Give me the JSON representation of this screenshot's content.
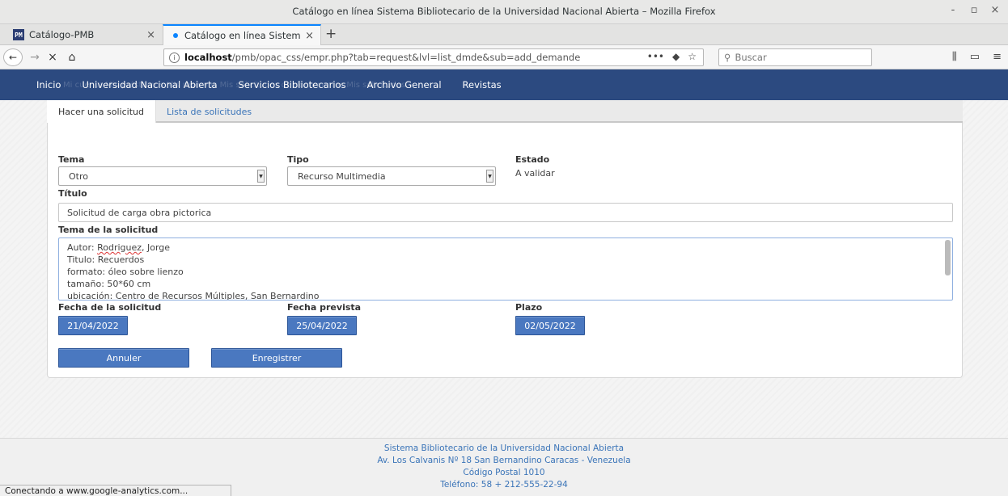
{
  "window": {
    "title": "Catálogo en línea Sistema Bibliotecario de la Universidad Nacional Abierta – Mozilla Firefox",
    "controls": {
      "minimize": "-",
      "maximize": "▫",
      "close": "×"
    }
  },
  "tabs": [
    {
      "label": "Catálogo-PMB",
      "close": "×",
      "favicon": "pmb-favicon"
    },
    {
      "label": "Catálogo en línea Sistem",
      "close": "×",
      "favicon": "loading-dot"
    }
  ],
  "newtab": "+",
  "nav": {
    "back": "←",
    "forward": "→",
    "stop": "×",
    "home": "⌂",
    "url_host": "localhost",
    "url_rest": "/pmb/opac_css/empr.php?tab=request&lvl=list_dmde&sub=add_demande",
    "url_more": "•••",
    "pocket": "◆",
    "star": "☆",
    "search_placeholder": "Buscar",
    "library": "⫼",
    "sidebar": "▭",
    "menu": "≡"
  },
  "sitemenu": {
    "items": [
      "Inicio",
      "Universidad Nacional Abierta",
      "Servicios Bibliotecarios",
      "Archivo General",
      "Revistas"
    ],
    "ghost_text": "Mi cuenta    Mis préstamos    Mis reservas    Mis solicitudes de documentos    Mis solicitudes"
  },
  "subtabs": {
    "active": "Hacer una solicitud",
    "link": "Lista de solicitudes"
  },
  "form": {
    "tema_label": "Tema",
    "tema_value": "Otro",
    "tipo_label": "Tipo",
    "tipo_value": "Recurso Multimedia",
    "estado_label": "Estado",
    "estado_value": "A validar",
    "titulo_label": "Título",
    "titulo_value": "Solicitud de carga obra pictorica",
    "tema_sol_label": "Tema de la solicitud",
    "tema_sol_lines": {
      "l1_prefix": "Autor: ",
      "l1_spell": "Rodriguez",
      "l1_suffix": ", Jorge",
      "l2": "Titulo: Recuerdos",
      "l3": "formato: óleo sobre lienzo",
      "l4": "tamaño: 50*60 cm",
      "l5": "ubicación: Centro de Recursos Múltiples, San Bernardino"
    },
    "fecha_sol_label": "Fecha de la solicitud",
    "fecha_sol_value": "21/04/2022",
    "fecha_prev_label": "Fecha prevista",
    "fecha_prev_value": "25/04/2022",
    "plazo_label": "Plazo",
    "plazo_value": "02/05/2022",
    "cancel_label": "Annuler",
    "save_label": "Enregistrer"
  },
  "footer": {
    "line1": "Sistema Bibliotecario de la Universidad Nacional Abierta",
    "line2": "Av. Los Calvanis Nº 18 San Bernandino Caracas - Venezuela",
    "line3": "Código Postal 1010",
    "line4": "Teléfono: 58 + 212-555-22-94"
  },
  "status": "Conectando a www.google-analytics.com..."
}
